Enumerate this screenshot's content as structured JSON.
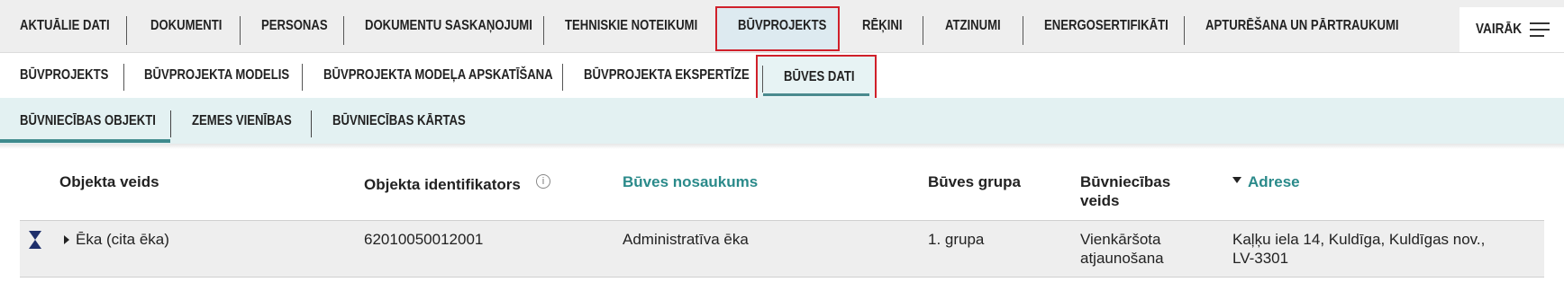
{
  "top_tabs": [
    {
      "label": "AKTUĀLIE DATI"
    },
    {
      "label": "DOKUMENTI"
    },
    {
      "label": "PERSONAS"
    },
    {
      "label": "DOKUMENTU SASKAŅOJUMI"
    },
    {
      "label": "TEHNISKIE NOTEIKUMI"
    },
    {
      "label": "BŪVPROJEKTS",
      "active": true
    },
    {
      "label": "RĒĶINI"
    },
    {
      "label": "ATZINUMI"
    },
    {
      "label": "ENERGOSERTIFIKĀTI"
    },
    {
      "label": "APTURĒŠANA UN PĀRTRAUKUMI"
    }
  ],
  "more_label": "VAIRĀK",
  "sub_tabs": [
    {
      "label": "BŪVPROJEKTS"
    },
    {
      "label": "BŪVPROJEKTA MODELIS"
    },
    {
      "label": "BŪVPROJEKTA MODEĻA APSKATĪŠANA"
    },
    {
      "label": "BŪVPROJEKTA EKSPERTĪZE"
    },
    {
      "label": "BŪVES DATI",
      "active": true
    }
  ],
  "third_tabs": [
    {
      "label": "BŪVNIECĪBAS OBJEKTI",
      "active": true
    },
    {
      "label": "ZEMES VIENĪBAS"
    },
    {
      "label": "BŪVNIECĪBAS KĀRTAS"
    }
  ],
  "table": {
    "headers": {
      "type": "Objekta veids",
      "id": "Objekta identifikators",
      "name": "Būves nosaukums",
      "group": "Būves grupa",
      "construction_line1": "Būvniecības",
      "construction_line2": "veids",
      "address": "Adrese"
    },
    "rows": [
      {
        "type": "Ēka (cita ēka)",
        "id": "62010050012001",
        "name": "Administratīva ēka",
        "group": "1. grupa",
        "construction_line1": "Vienkāršota",
        "construction_line2": "atjaunošana",
        "address_line1": "Kaļķu iela 14, Kuldīga, Kuldīgas nov.,",
        "address_line2": "LV-3301"
      }
    ]
  },
  "colors": {
    "accent": "#2a8a8a",
    "highlight_border": "#d0202a",
    "subnav_bg": "#e3f1f2"
  }
}
